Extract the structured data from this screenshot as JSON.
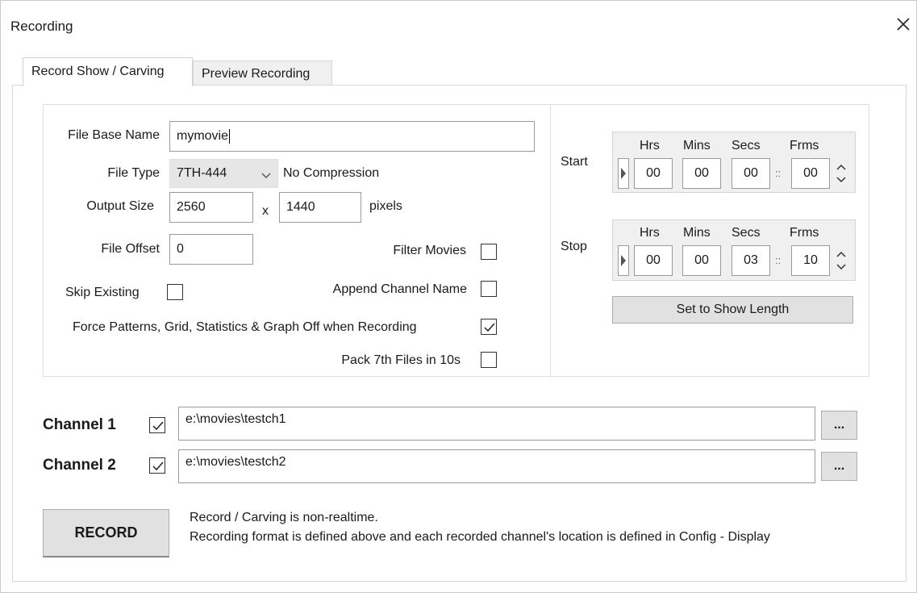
{
  "window": {
    "title": "Recording",
    "close_icon": "close-icon"
  },
  "tabs": [
    {
      "label": "Record Show / Carving",
      "active": true
    },
    {
      "label": "Preview Recording",
      "active": false
    }
  ],
  "settings": {
    "file_base_name_label": "File Base Name",
    "file_base_name_value": "mymovie",
    "file_type_label": "File Type",
    "file_type_value": "7TH-444",
    "file_type_note": "No Compression",
    "output_size_label": "Output Size",
    "output_width": "2560",
    "output_x": "x",
    "output_height": "1440",
    "output_unit": "pixels",
    "file_offset_label": "File Offset",
    "file_offset_value": "0",
    "filter_movies_label": "Filter Movies",
    "filter_movies_checked": false,
    "skip_existing_label": "Skip Existing",
    "skip_existing_checked": false,
    "append_channel_label": "Append Channel Name",
    "append_channel_checked": false,
    "force_patterns_label": "Force Patterns, Grid, Statistics & Graph Off when Recording",
    "force_patterns_checked": true,
    "pack_7th_label": "Pack 7th Files in 10s",
    "pack_7th_checked": false
  },
  "timecode": {
    "headers": [
      "Hrs",
      "Mins",
      "Secs",
      "Frms"
    ],
    "start_label": "Start",
    "start_values": [
      "00",
      "00",
      "00",
      "00"
    ],
    "stop_label": "Stop",
    "stop_values": [
      "00",
      "00",
      "03",
      "10"
    ],
    "separator": "::",
    "set_show_length_label": "Set to Show Length"
  },
  "channels": [
    {
      "label": "Channel 1",
      "checked": true,
      "path": "e:\\movies\\testch1",
      "browse_label": "..."
    },
    {
      "label": "Channel 2",
      "checked": true,
      "path": "e:\\movies\\testch2",
      "browse_label": "..."
    }
  ],
  "record": {
    "button_label": "RECORD",
    "note_line1": "Record / Carving is non-realtime.",
    "note_line2": "Recording format is defined above and each recorded channel's location is defined in Config - Display"
  }
}
